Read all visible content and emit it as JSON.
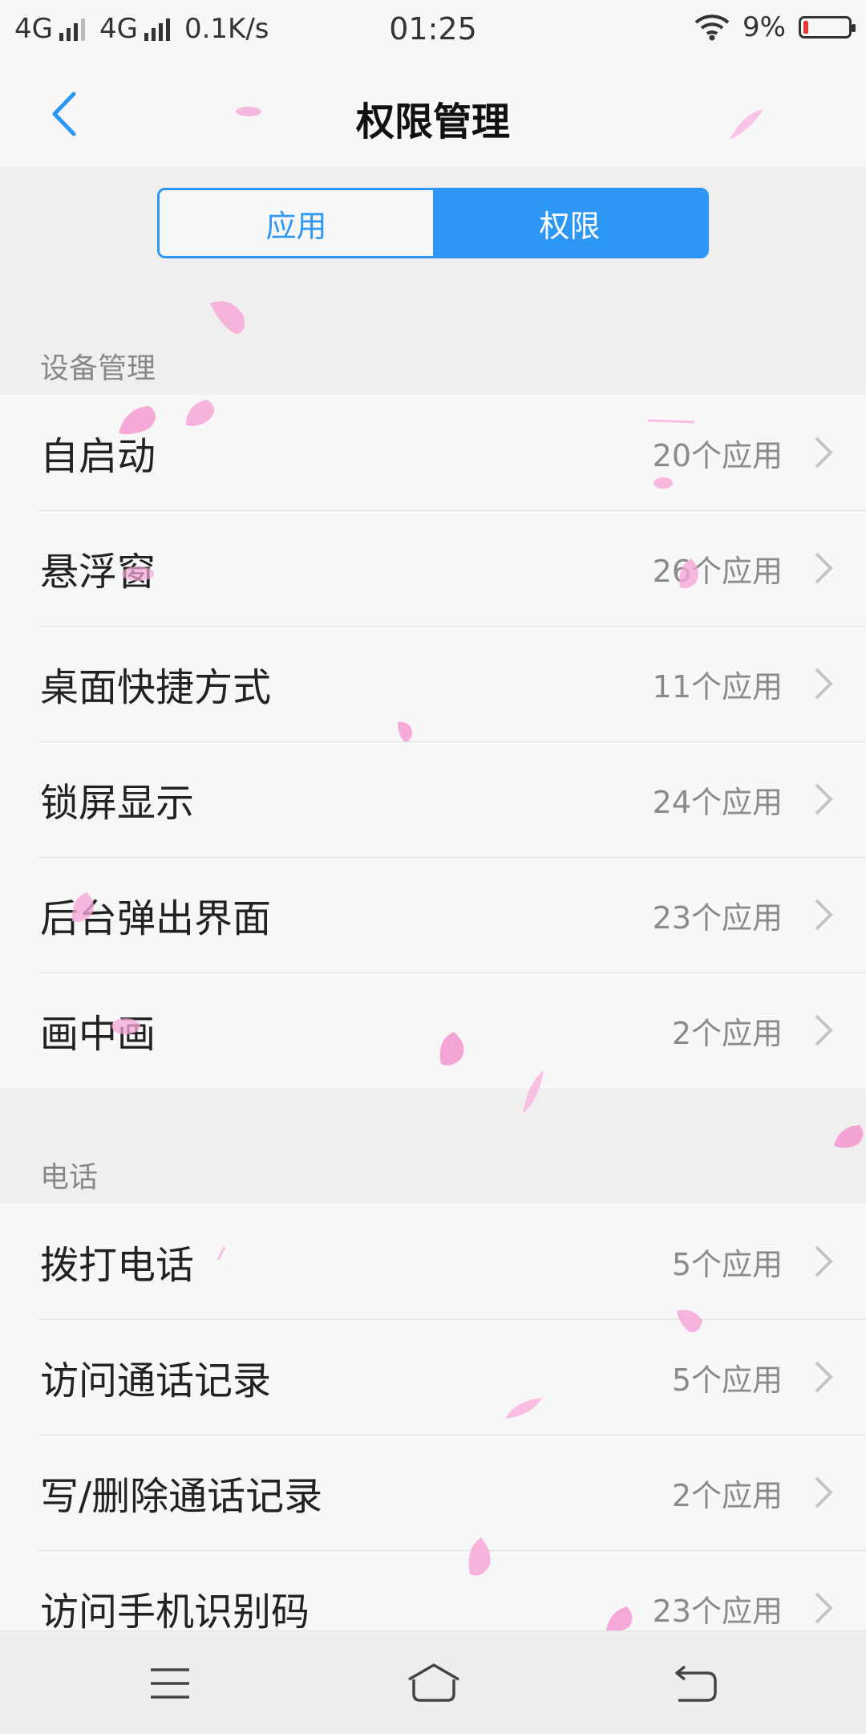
{
  "status_bar": {
    "sim1": "4G",
    "sim2": "4G",
    "speed": "0.1K/s",
    "time": "01:25",
    "battery": "9%",
    "icons": [
      "signal-icon",
      "wifi-icon",
      "battery-icon"
    ]
  },
  "nav": {
    "title": "权限管理",
    "back_icon": "chevron-left-icon"
  },
  "segment": {
    "tabs": [
      {
        "label": "应用",
        "active": false
      },
      {
        "label": "权限",
        "active": true
      }
    ]
  },
  "sections": [
    {
      "title": "设备管理",
      "items": [
        {
          "label": "自启动",
          "count": "20个应用"
        },
        {
          "label": "悬浮窗",
          "count": "26个应用"
        },
        {
          "label": "桌面快捷方式",
          "count": "11个应用"
        },
        {
          "label": "锁屏显示",
          "count": "24个应用"
        },
        {
          "label": "后台弹出界面",
          "count": "23个应用"
        },
        {
          "label": "画中画",
          "count": "2个应用"
        }
      ]
    },
    {
      "title": "电话",
      "items": [
        {
          "label": "拨打电话",
          "count": "5个应用"
        },
        {
          "label": "访问通话记录",
          "count": "5个应用"
        },
        {
          "label": "写/删除通话记录",
          "count": "2个应用"
        },
        {
          "label": "访问手机识别码",
          "count": "23个应用"
        }
      ]
    }
  ],
  "bottom_nav": {
    "icons": [
      "menu-icon",
      "home-icon",
      "back-icon"
    ]
  },
  "colors": {
    "accent": "#2d97f5",
    "background": "#efefef",
    "list_background": "#f7f7f7",
    "petal": "#f6a8d8"
  }
}
